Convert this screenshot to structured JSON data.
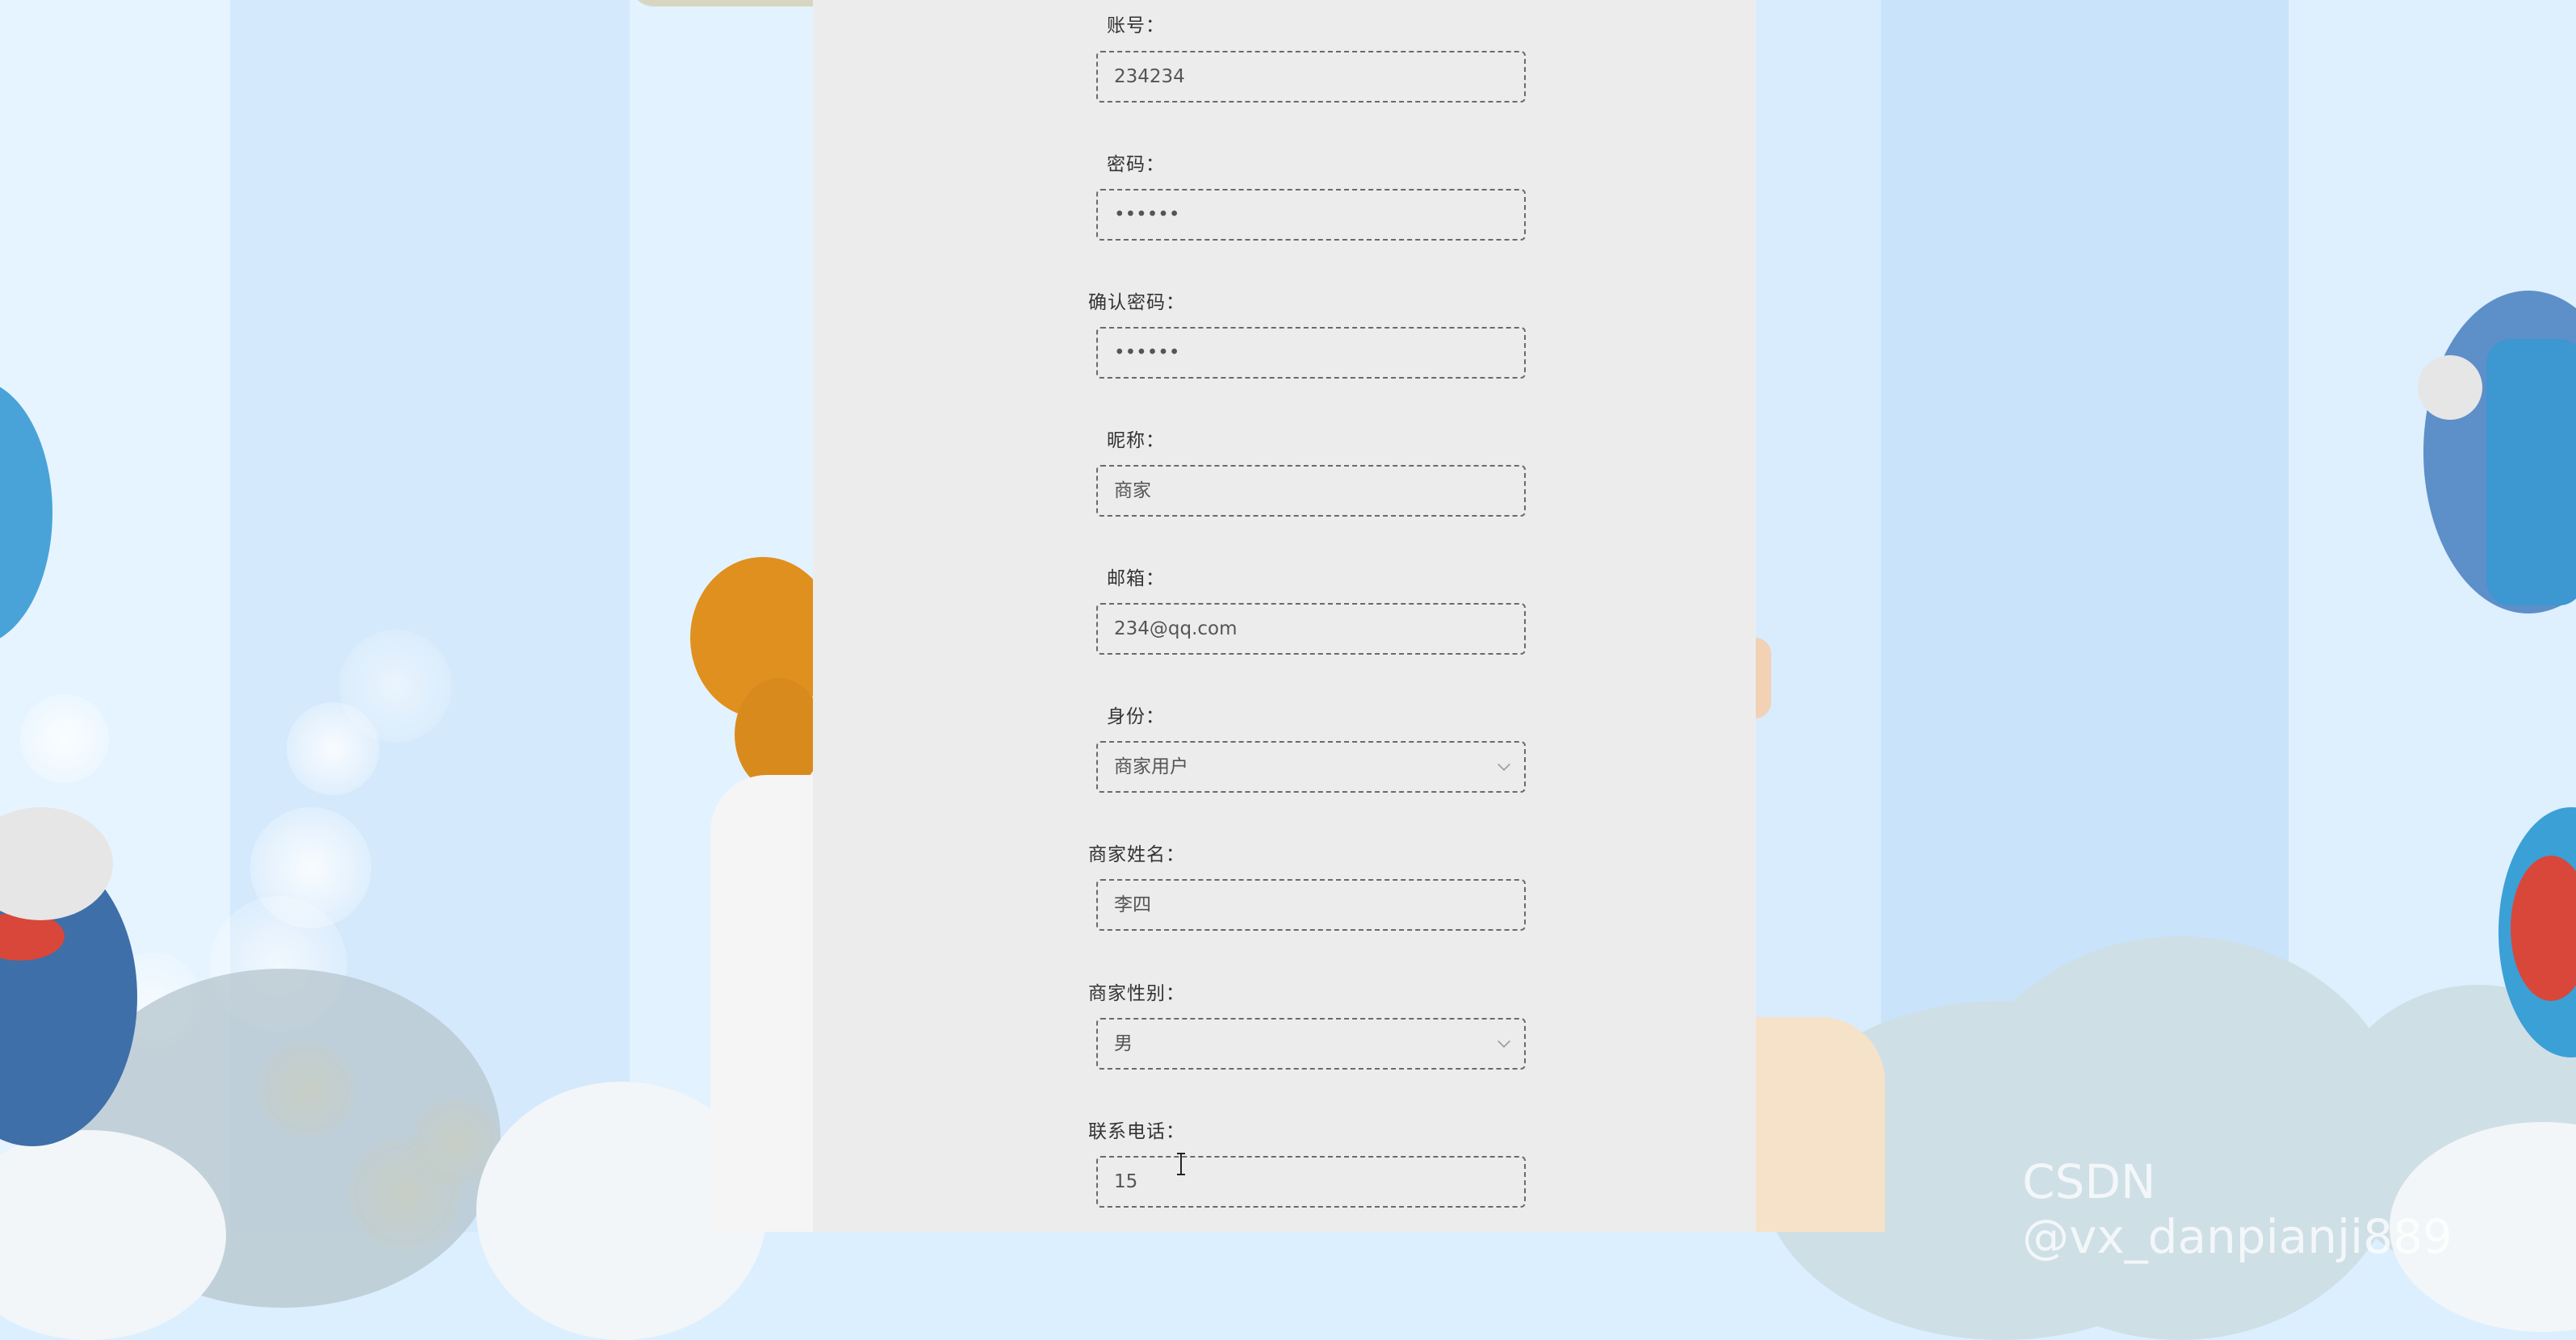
{
  "form": {
    "fields": [
      {
        "label": "账号：",
        "value": "234234"
      },
      {
        "label": "密码：",
        "value": "••••••"
      },
      {
        "label": "确认密码：",
        "value": "••••••"
      },
      {
        "label": "昵称：",
        "value": "商家"
      },
      {
        "label": "邮箱：",
        "value": "234@qq.com"
      },
      {
        "label": "身份：",
        "value": "商家用户",
        "type": "select"
      },
      {
        "label": "商家姓名：",
        "value": "李四"
      },
      {
        "label": "商家性别：",
        "value": "男",
        "type": "select"
      },
      {
        "label": "联系电话：",
        "value": "15"
      }
    ]
  },
  "watermark": "CSDN @vx_danpianji889"
}
